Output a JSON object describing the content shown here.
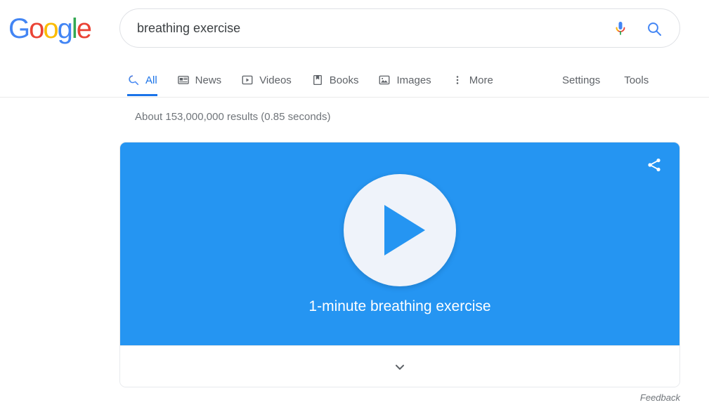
{
  "brand": {
    "name": "Google",
    "letters": [
      {
        "char": "G",
        "color": "#4285f4"
      },
      {
        "char": "o",
        "color": "#ea4335"
      },
      {
        "char": "o",
        "color": "#fbbc05"
      },
      {
        "char": "g",
        "color": "#4285f4"
      },
      {
        "char": "l",
        "color": "#34a853"
      },
      {
        "char": "e",
        "color": "#ea4335"
      }
    ]
  },
  "search": {
    "query": "breathing exercise",
    "placeholder": "Search Google or type a URL",
    "mic_icon": "microphone-icon",
    "submit_icon": "search-icon"
  },
  "nav": {
    "tabs": [
      {
        "label": "All",
        "icon": "google-search-icon",
        "active": true
      },
      {
        "label": "News",
        "icon": "news-icon",
        "active": false
      },
      {
        "label": "Videos",
        "icon": "video-icon",
        "active": false
      },
      {
        "label": "Books",
        "icon": "book-icon",
        "active": false
      },
      {
        "label": "Images",
        "icon": "image-icon",
        "active": false
      },
      {
        "label": "More",
        "icon": "more-vertical-icon",
        "active": false
      }
    ],
    "settings_label": "Settings",
    "tools_label": "Tools",
    "active_color": "#1a73e8"
  },
  "results": {
    "stats": "About 153,000,000 results (0.85 seconds)"
  },
  "card": {
    "title": "1-minute breathing exercise",
    "background_color": "#2595f2",
    "play_icon": "play-icon",
    "share_icon": "share-icon",
    "expand_icon": "chevron-down-icon"
  },
  "footer": {
    "feedback_label": "Feedback"
  }
}
